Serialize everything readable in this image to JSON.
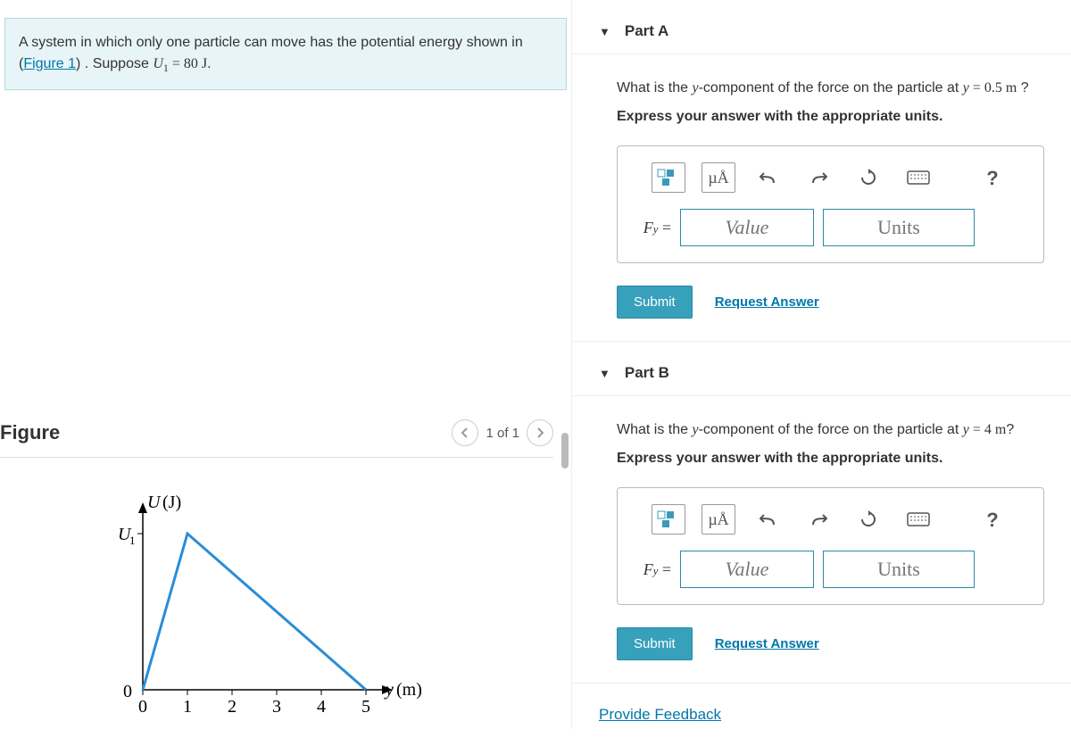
{
  "problem": {
    "text_prefix": "A system in which only one particle can move has the potential energy shown in (",
    "figure_link": "Figure 1",
    "text_mid": ") . Suppose ",
    "variable_html": "U₁ = 80 J",
    "text_suffix": "."
  },
  "figure": {
    "title": "Figure",
    "pager": "1 of 1",
    "y_axis_label": "U (J)",
    "y_tick_top": "U₁",
    "y_tick_bottom": "0",
    "x_axis_label": "y (m)",
    "x_ticks": [
      "0",
      "1",
      "2",
      "3",
      "4",
      "5"
    ]
  },
  "toolbar": {
    "units_symbol": "µÅ",
    "help_symbol": "?"
  },
  "parts": [
    {
      "label": "Part A",
      "question_prefix": "What is the ",
      "question_var": "y",
      "question_mid": "-component of the force on the particle at ",
      "equation": "y = 0.5 m",
      "question_suffix": " ?",
      "instruction": "Express your answer with the appropriate units.",
      "answer_label": "F_y =",
      "value_placeholder": "Value",
      "units_placeholder": "Units",
      "submit": "Submit",
      "request": "Request Answer"
    },
    {
      "label": "Part B",
      "question_prefix": "What is the ",
      "question_var": "y",
      "question_mid": "-component of the force on the particle at ",
      "equation": "y = 4 m",
      "question_suffix": "?",
      "instruction": "Express your answer with the appropriate units.",
      "answer_label": "F_y =",
      "value_placeholder": "Value",
      "units_placeholder": "Units",
      "submit": "Submit",
      "request": "Request Answer"
    }
  ],
  "feedback_link": "Provide Feedback",
  "chart_data": {
    "type": "line",
    "title": "Potential energy vs position",
    "xlabel": "y (m)",
    "ylabel": "U (J)",
    "x": [
      0,
      1,
      5
    ],
    "y": [
      0,
      80,
      0
    ],
    "xlim": [
      0,
      5
    ],
    "ylim": [
      0,
      80
    ],
    "y_tick_labels": {
      "0": "0",
      "80": "U₁"
    },
    "note": "U₁ = 80 J; straight segments 0→1 rising, 1→5 falling"
  }
}
